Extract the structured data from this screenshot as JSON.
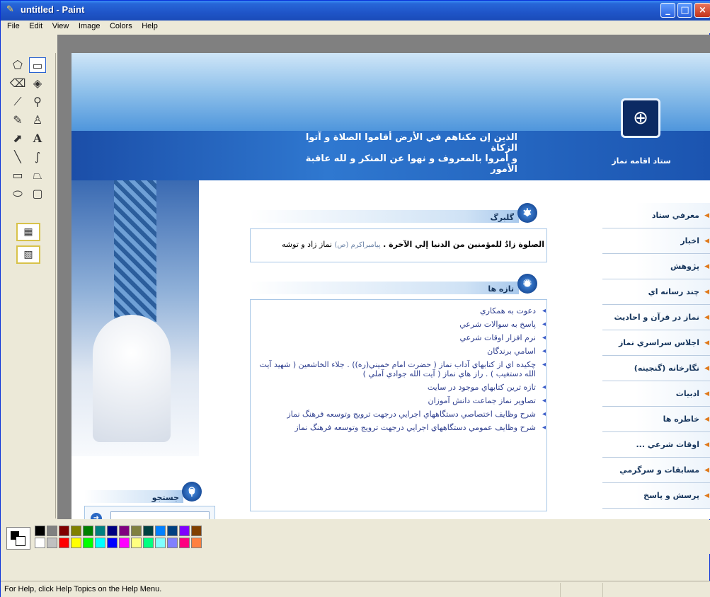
{
  "window": {
    "title": "untitled - Paint"
  },
  "menubar": {
    "items": [
      "File",
      "Edit",
      "View",
      "Image",
      "Colors",
      "Help"
    ]
  },
  "toolbox": {
    "tools": [
      "free-select-icon",
      "rect-select-icon",
      "eraser-icon",
      "fill-icon",
      "picker-icon",
      "magnifier-icon",
      "pencil-icon",
      "brush-icon",
      "airbrush-icon",
      "text-icon",
      "line-icon",
      "curve-icon",
      "rectangle-icon",
      "polygon-icon",
      "ellipse-icon",
      "rounded-rect-icon"
    ],
    "text_tool_glyph": "A"
  },
  "page": {
    "banner": {
      "verse_line1": "الذين إن مكناهم في الأرض أقاموا الصلاة و آتوا الزكاة",
      "verse_line2": "و أمروا بالمعروف و نهوا عن المنكر و لله عاقبة الأمور",
      "site_name": "ستاد اقامه نماز"
    },
    "gallery": {
      "title": "گلبرگ",
      "quote": "الصلوة زادٌ للمؤمنين من الدنيا إلي الآخرة .",
      "source": "پیامبراکرم (ص)",
      "caption": "نماز زاد و توشه"
    },
    "news": {
      "title": "تازه ها",
      "items": [
        "دعوت به همكاري",
        "پاسخ به سوالات شرعي",
        "نرم افزار اوقات شرعي",
        "اسامي برندگان",
        "چكيده اي از كتابهاي آداب نماز ( حضرت امام خميني(ره)) . جلاء الخاشعين ( شهيد آيت الله دستغيب ) . راز هاي نماز ( آيت الله جوادي آملي )",
        "تازه ترين كتابهاي موجود در سايت",
        "تصاوير نماز جماعت دانش آموزان",
        "شرح وظايف اختصاصي دستگاههاي اجرايي درجهت ترويج وتوسعه فرهنگ نماز",
        "شرح وظايف عمومي دستگاههاي اجرايي درجهت ترويج وتوسعه فرهنگ نماز"
      ]
    },
    "search": {
      "title": "جستجو",
      "placeholder": ""
    },
    "menu": {
      "items": [
        "معرفي ستاد",
        "اخبار",
        "پژوهش",
        "چند رسانه اي",
        "نماز در قرآن و احاديث",
        "اجلاس سراسري نماز",
        "نگارخانه (گنجينه)",
        "ادبيات",
        "خاطره ها",
        "اوقات شرعي ...",
        "مسابقات و سرگرمي",
        "پرسش و پاسخ"
      ]
    }
  },
  "palette": {
    "colors_row1": [
      "#000000",
      "#808080",
      "#800000",
      "#808000",
      "#008000",
      "#008080",
      "#000080",
      "#800080",
      "#808040",
      "#004040",
      "#0080ff",
      "#004080",
      "#8000ff",
      "#804000"
    ],
    "colors_row2": [
      "#ffffff",
      "#c0c0c0",
      "#ff0000",
      "#ffff00",
      "#00ff00",
      "#00ffff",
      "#0000ff",
      "#ff00ff",
      "#ffff80",
      "#00ff80",
      "#80ffff",
      "#8080ff",
      "#ff0080",
      "#ff8040"
    ]
  },
  "statusbar": {
    "text": "For Help, click Help Topics on the Help Menu."
  }
}
